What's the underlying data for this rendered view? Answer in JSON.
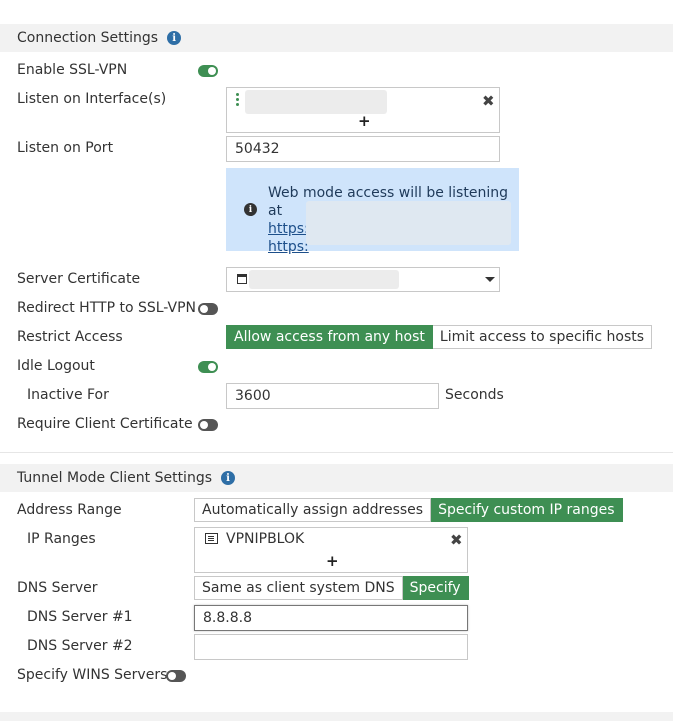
{
  "connection": {
    "title": "Connection Settings",
    "enable_ssl_vpn": {
      "label": "Enable SSL-VPN",
      "on": true
    },
    "listen_interfaces": {
      "label": "Listen on Interface(s)",
      "add_symbol": "+",
      "remove_symbol": "✖"
    },
    "listen_port": {
      "label": "Listen on Port",
      "value": "50432"
    },
    "info_box": {
      "text": "Web mode access will be listening at",
      "link1": "https:",
      "link2": "https:"
    },
    "server_certificate": {
      "label": "Server Certificate"
    },
    "redirect_http": {
      "label": "Redirect HTTP to SSL-VPN",
      "on": false
    },
    "restrict_access": {
      "label": "Restrict Access",
      "options": [
        "Allow access from any host",
        "Limit access to specific hosts"
      ],
      "selected": 0
    },
    "idle_logout": {
      "label": "Idle Logout",
      "on": true
    },
    "inactive_for": {
      "label": "Inactive For",
      "value": "3600",
      "unit": "Seconds"
    },
    "require_client_cert": {
      "label": "Require Client Certificate",
      "on": false
    }
  },
  "tunnel": {
    "title": "Tunnel Mode Client Settings",
    "address_range": {
      "label": "Address Range",
      "options": [
        "Automatically assign addresses",
        "Specify custom IP ranges"
      ],
      "selected": 1
    },
    "ip_ranges": {
      "label": "IP Ranges",
      "item": "VPNIPBLOK",
      "add_symbol": "+",
      "remove_symbol": "✖"
    },
    "dns_server": {
      "label": "DNS Server",
      "options": [
        "Same as client system DNS",
        "Specify"
      ],
      "selected": 1
    },
    "dns1": {
      "label": "DNS Server #1",
      "value": "8.8.8.8"
    },
    "dns2": {
      "label": "DNS Server #2",
      "value": ""
    },
    "wins": {
      "label": "Specify WINS Servers",
      "on": false
    }
  },
  "icons": {
    "info": "info-icon",
    "close": "close-icon",
    "add": "plus-icon",
    "caret": "chevron-down-icon"
  },
  "colors": {
    "accent_green": "#3e8f53",
    "info_blue": "#2e6ea6",
    "info_box_bg": "#cfe4fb"
  }
}
